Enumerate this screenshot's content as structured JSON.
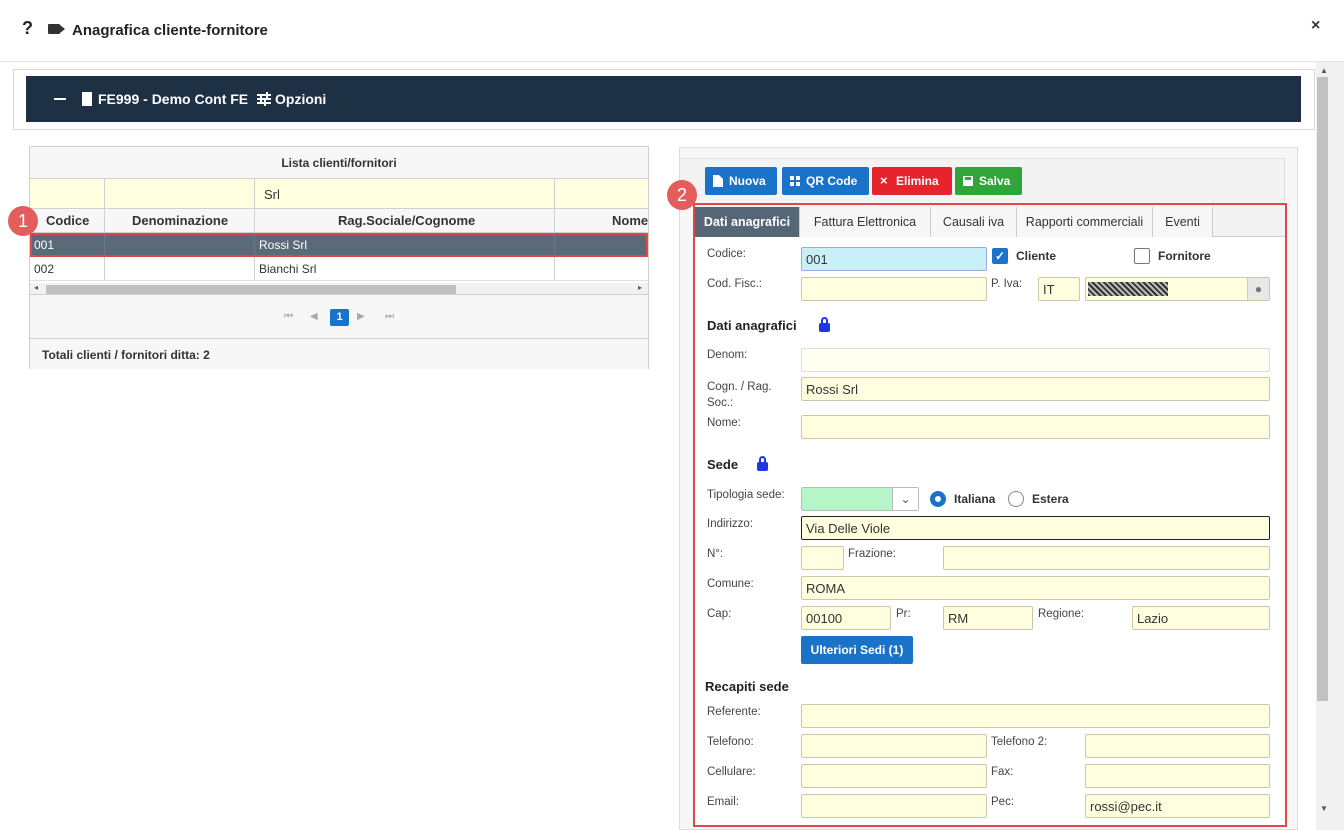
{
  "window": {
    "help": "?",
    "title": "Anagrafica cliente-fornitore",
    "close": "×"
  },
  "header": {
    "company": "FE999 - Demo Cont FE",
    "options": "Opzioni"
  },
  "list": {
    "caption": "Lista clienti/fornitori",
    "filter": "Srl",
    "columns": [
      "Codice",
      "Denominazione",
      "Rag.Sociale/Cognome",
      "Nome"
    ],
    "rows": [
      {
        "code": "001",
        "denom": "",
        "rag": "Rossi Srl",
        "name": ""
      },
      {
        "code": "002",
        "denom": "",
        "rag": "Bianchi Srl",
        "name": ""
      }
    ],
    "page": "1",
    "totals": "Totali clienti / fornitori ditta: 2"
  },
  "badges": {
    "one": "1",
    "two": "2"
  },
  "toolbar": {
    "new": "Nuova",
    "qr": "QR Code",
    "delete": "Elimina",
    "save": "Salva"
  },
  "tabs": [
    "Dati anagrafici",
    "Fattura Elettronica",
    "Causali iva",
    "Rapporti commerciali",
    "Eventi"
  ],
  "form": {
    "codice_label": "Codice:",
    "codice": "001",
    "cliente": "Cliente",
    "fornitore": "Fornitore",
    "codfisc_label": "Cod. Fisc.:",
    "piva_label": "P. Iva:",
    "piva_country": "IT",
    "sec_anag": "Dati anagrafici",
    "denom_label": "Denom:",
    "denom": "",
    "cogn_label": "Cogn. / Rag. Soc.:",
    "cogn": "Rossi Srl",
    "nome_label": "Nome:",
    "nome": "",
    "sec_sede": "Sede",
    "tipologia_label": "Tipologia sede:",
    "italiana": "Italiana",
    "estera": "Estera",
    "indirizzo_label": "Indirizzo:",
    "indirizzo": "Via Delle Viole",
    "num_label": "N°:",
    "frazione_label": "Frazione:",
    "comune_label": "Comune:",
    "comune": "ROMA",
    "cap_label": "Cap:",
    "cap": "00100",
    "pr_label": "Pr:",
    "pr": "RM",
    "regione_label": "Regione:",
    "regione": "Lazio",
    "ulteriori": "Ulteriori Sedi (1)",
    "sec_recapiti": "Recapiti sede",
    "referente_label": "Referente:",
    "telefono_label": "Telefono:",
    "telefono2_label": "Telefono 2:",
    "cellulare_label": "Cellulare:",
    "fax_label": "Fax:",
    "email_label": "Email:",
    "pec_label": "Pec:",
    "pec": "rossi@pec.it"
  },
  "colors": {
    "header_bg": "#1e3044",
    "accent": "#1a73c8",
    "danger": "#e5242c",
    "success": "#30a53a",
    "highlight": "#e04848",
    "field_bg": "#ffffe0"
  }
}
